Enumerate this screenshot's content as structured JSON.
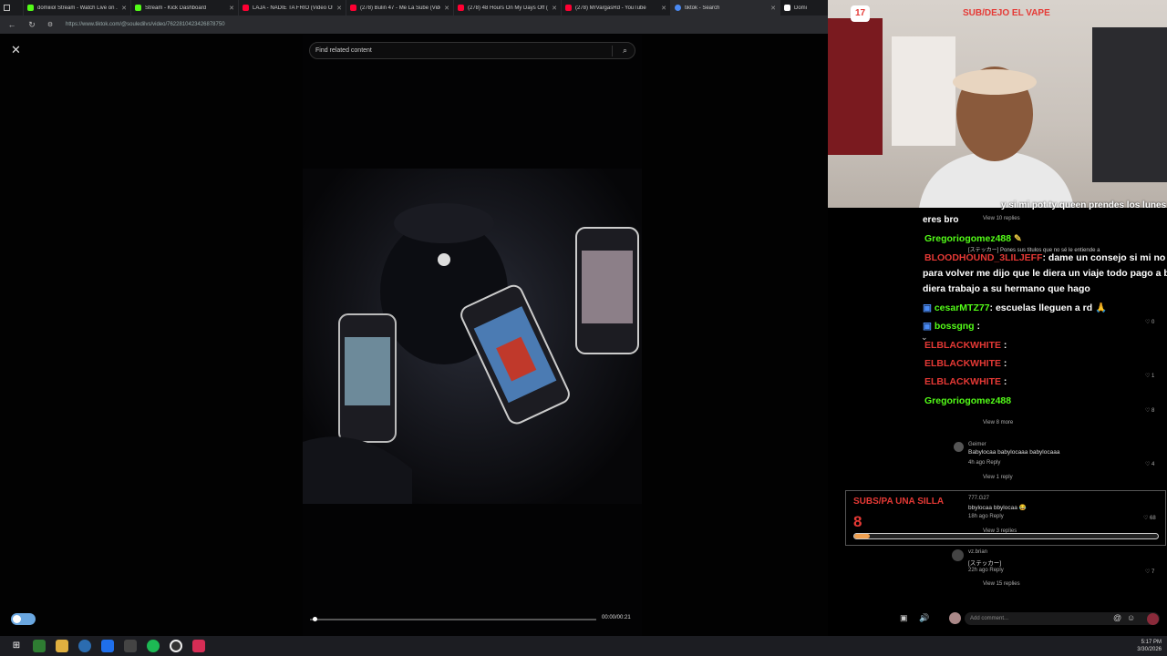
{
  "browser": {
    "tabs": [
      {
        "title": "domiiiol Stream - Watch Live on ...",
        "color": "#53fc18"
      },
      {
        "title": "Stream - Kick Dashboard",
        "color": "#53fc18"
      },
      {
        "title": "LAJA - NADIE TA FRIO (Video Of...",
        "color": "#ff0033"
      },
      {
        "title": "(278) Bulin 47 - Me La Sube (Vide...",
        "color": "#ff0033"
      },
      {
        "title": "(278) 48 Hours On My Days Off (I...",
        "color": "#ff0033"
      },
      {
        "title": "(278) MrVargasRd - YouTube",
        "color": "#ff0033"
      },
      {
        "title": "tiktok - Search",
        "color": "#4a8af4"
      },
      {
        "title": "Domi",
        "color": "#ffffff"
      }
    ],
    "url": "https://www.tiktok.com/@souledilvs/video/7622810423426878750"
  },
  "tiktok": {
    "search_placeholder": "Find related content",
    "time": "00:00/00:21",
    "progress": 0.01
  },
  "stream": {
    "badge": "17",
    "title": "SUB/DEJO EL VAPE",
    "goal_title": "SUBS/PA UNA SILLA",
    "goal_value": "8",
    "goal_progress": 0.05
  },
  "chat": [
    {
      "user": "",
      "text": "y si mi pot ty queen prendes los lunes",
      "continued": "eres bro",
      "color": "#e53935"
    },
    {
      "user": "Gregoriogomez488",
      "text": "",
      "color": "#53fc18"
    },
    {
      "user": "BLOODHOUND_3LILJEFF",
      "text": ": dame un consejo si mi no",
      "continued": "para volver me dijo que le diera un viaje todo pago a b",
      "continued2": "diera trabajo a su hermano que hago",
      "color": "#e53935"
    },
    {
      "user": "cesarMTZ77",
      "text": ": escuelas lleguen a rd 🙏",
      "color": "#53fc18"
    },
    {
      "user": "bossgng",
      "text": ":",
      "color": "#53fc18"
    },
    {
      "user": "ELBLACKWHITE",
      "text": ":",
      "color": "#e53935"
    },
    {
      "user": "ELBLACKWHITE",
      "text": ":",
      "color": "#e53935"
    },
    {
      "user": "ELBLACKWHITE",
      "text": ":",
      "color": "#e53935"
    },
    {
      "user": "Gregoriogomez488",
      "text": "",
      "color": "#53fc18"
    }
  ],
  "comments": {
    "view_10": "View 10 replies",
    "sticker_line": "[ステッカー] Pones sus titulos que no sé le entiende a",
    "view_8": "View 8 more",
    "geimer_user": "Geimer",
    "geimer_text": "Babylocaa babylocaaa babylocaaa",
    "geimer_meta": "4h ago  Reply",
    "geimer_likes": "4",
    "view_1": "View 1 reply",
    "u777_user": "777.G27",
    "u777_text": "bbylocaa bbylocaa 😂",
    "u777_meta": "18h ago  Reply",
    "u777_likes": "68",
    "view_3": "View 3 replies",
    "vz_user": "vz.brian",
    "vz_text": "[ステッカー]",
    "vz_meta": "22h ago  Reply",
    "vz_likes": "7",
    "view_15": "View 15 replies",
    "add_placeholder": "Add comment...",
    "likes_1": "0",
    "likes_2": "1",
    "likes_3": "8"
  },
  "clock": {
    "time": "5:17 PM",
    "date": "3/30/2026"
  }
}
